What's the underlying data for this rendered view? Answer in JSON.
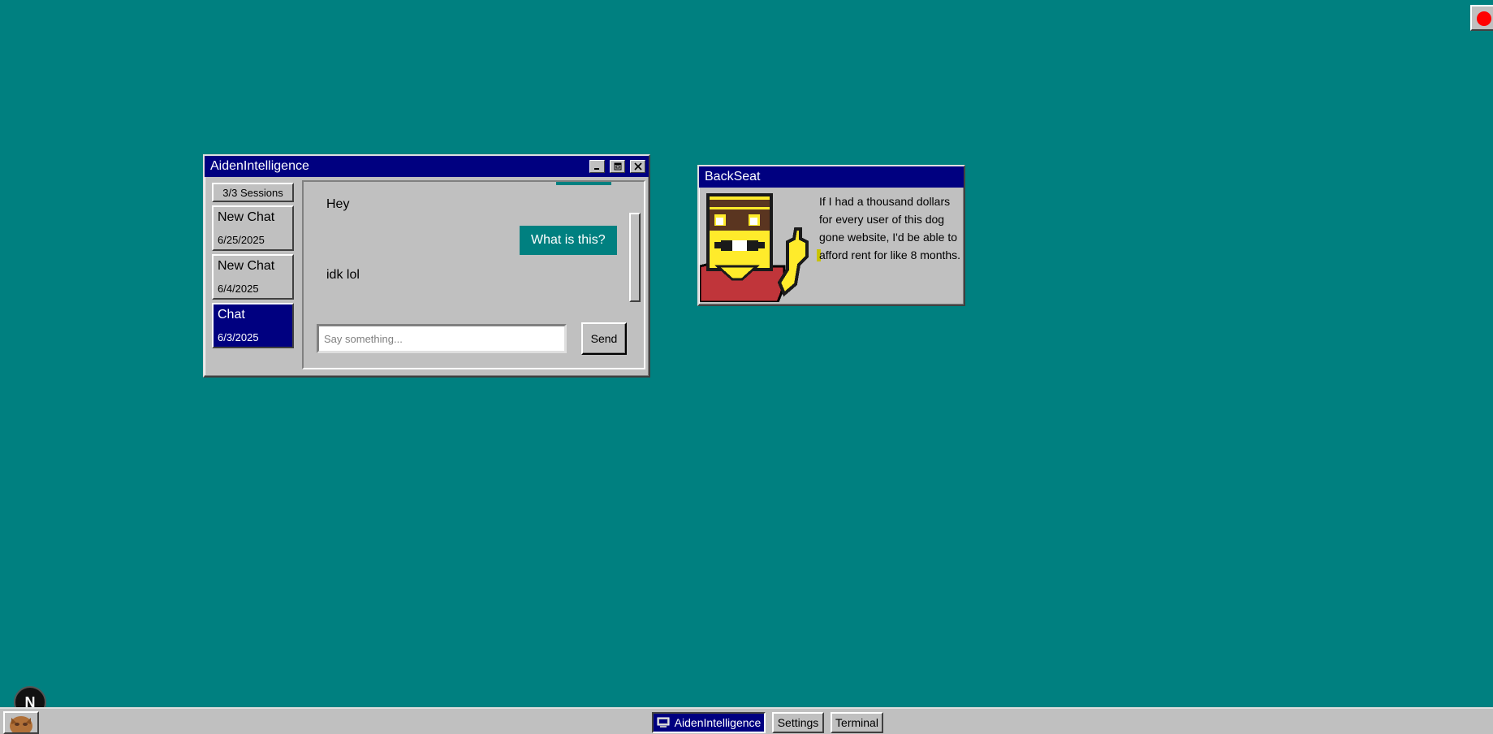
{
  "main_window": {
    "title": "AidenIntelligence",
    "sessions_label": "3/3 Sessions",
    "sessions": [
      {
        "title": "New Chat",
        "date": "6/25/2025",
        "active": false
      },
      {
        "title": "New Chat",
        "date": "6/4/2025",
        "active": false
      },
      {
        "title": "Chat",
        "date": "6/3/2025",
        "active": true
      }
    ],
    "messages": [
      {
        "role": "bot",
        "text": "Hey"
      },
      {
        "role": "user",
        "text": "What is this?"
      },
      {
        "role": "bot",
        "text": "idk lol"
      }
    ],
    "input_placeholder": "Say something...",
    "input_value": "",
    "send_label": "Send"
  },
  "backseat_window": {
    "title": "BackSeat",
    "text": "If I had a thousand dollars for every user of this dog gone website, I'd be able to afford rent for like 8 months."
  },
  "taskbar": {
    "items": [
      {
        "label": "AidenIntelligence",
        "active": true
      },
      {
        "label": "Settings",
        "active": false
      },
      {
        "label": "Terminal",
        "active": false
      }
    ]
  },
  "badge": {
    "letter": "N"
  },
  "colors": {
    "desktop": "#008080",
    "title_bar": "#000080",
    "window": "#c0c0c0",
    "user_bubble": "#008080",
    "record_dot": "#ff0000"
  },
  "icons": [
    "minimize-icon",
    "maximize-icon",
    "close-icon",
    "computer-icon",
    "record-icon"
  ]
}
